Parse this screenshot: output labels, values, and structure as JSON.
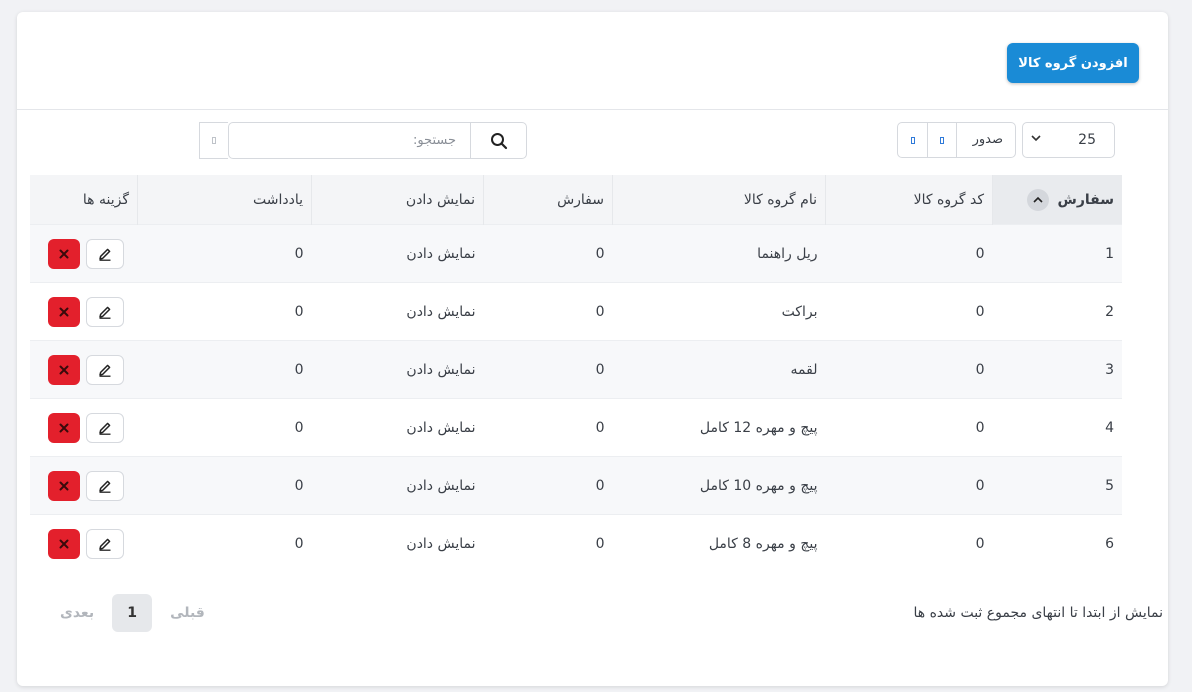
{
  "header": {
    "add_button": "افزودن گروه کالا"
  },
  "controls": {
    "page_length": "25",
    "export_label": "صدور",
    "search_placeholder": "جستجو:"
  },
  "table": {
    "columns": [
      "سفارش",
      "کد گروه کالا",
      "نام گروه کالا",
      "سفارش",
      "نمایش دادن",
      "یادداشت",
      "گزینه ها"
    ],
    "rows": [
      {
        "order": "1",
        "code": "0",
        "name": "ریل راهنما",
        "sort": "0",
        "show": "نمایش دادن",
        "note": "0"
      },
      {
        "order": "2",
        "code": "0",
        "name": "براکت",
        "sort": "0",
        "show": "نمایش دادن",
        "note": "0"
      },
      {
        "order": "3",
        "code": "0",
        "name": "لقمه",
        "sort": "0",
        "show": "نمایش دادن",
        "note": "0"
      },
      {
        "order": "4",
        "code": "0",
        "name": "پیچ و مهره 12 کامل",
        "sort": "0",
        "show": "نمایش دادن",
        "note": "0"
      },
      {
        "order": "5",
        "code": "0",
        "name": "پیچ و مهره 10 کامل",
        "sort": "0",
        "show": "نمایش دادن",
        "note": "0"
      },
      {
        "order": "6",
        "code": "0",
        "name": "پیچ و مهره 8 کامل",
        "sort": "0",
        "show": "نمایش دادن",
        "note": "0"
      }
    ]
  },
  "footer": {
    "info": "نمایش از ابتدا تا انتهای مجموع ثبت شده ها",
    "prev": "قبلی",
    "current": "1",
    "next": "بعدی"
  },
  "colors": {
    "primary": "#1a8bd6",
    "danger": "#e3202c"
  }
}
